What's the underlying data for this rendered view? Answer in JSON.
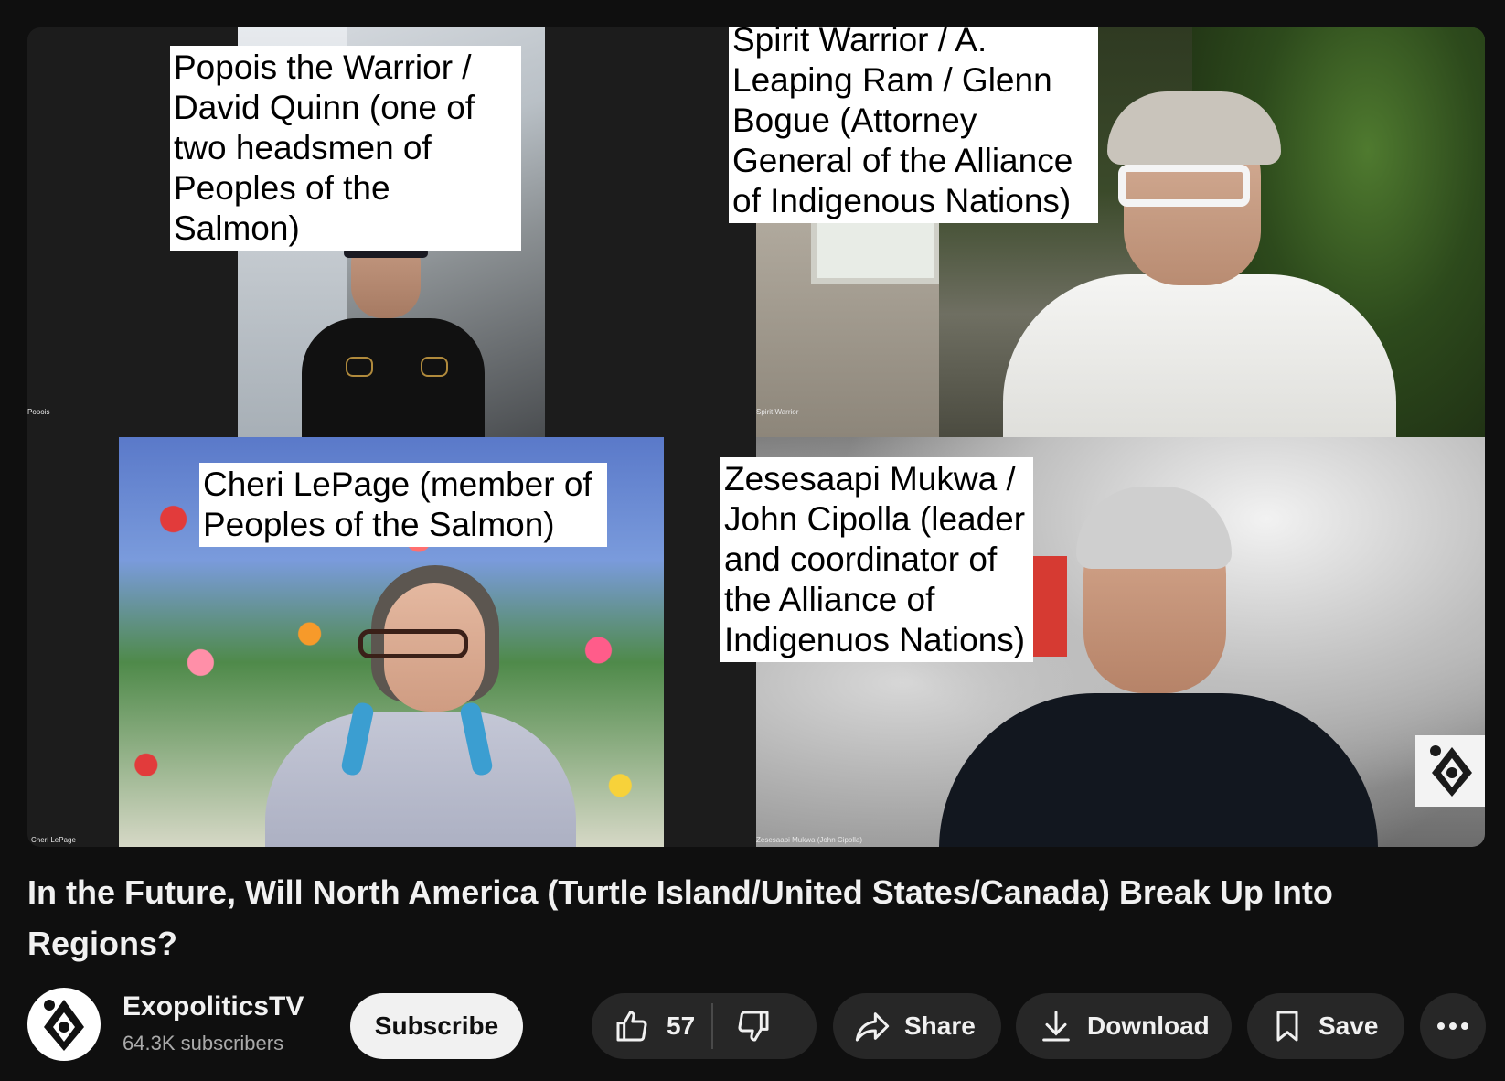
{
  "video": {
    "tiles": [
      {
        "name_tag": "Popois",
        "caption": "Popois the Warrior / David Quinn (one of two headsmen of Peoples of the Salmon)"
      },
      {
        "name_tag": "Spirit Warrior",
        "caption": "Spirit Warrior / A. Leaping Ram / Glenn Bogue (Attorney General of the Alliance of Indigenous Nations)"
      },
      {
        "name_tag": "Cheri LePage",
        "caption": "Cheri LePage (member of Peoples of the Salmon)"
      },
      {
        "name_tag": "Zesesaapi Mukwa (John Cipolla)",
        "caption": "Zesesaapi Mukwa / John Cipolla (leader and coordinator of the Alliance of Indigenuos Nations)"
      }
    ],
    "watermark_icon": "exopolitics-logo-icon"
  },
  "title": "In the Future, Will North America (Turtle Island/United States/Canada) Break Up Into Regions?",
  "channel": {
    "name": "ExopoliticsTV",
    "subscribers": "64.3K subscribers",
    "avatar_icon": "exopolitics-logo-icon"
  },
  "actions": {
    "subscribe_label": "Subscribe",
    "like_count": "57",
    "share_label": "Share",
    "download_label": "Download",
    "save_label": "Save"
  },
  "colors": {
    "background": "#0f0f0f",
    "button_bg": "#272727",
    "subscribe_bg": "#f1f1f1",
    "text_secondary": "#aaaaaa"
  }
}
